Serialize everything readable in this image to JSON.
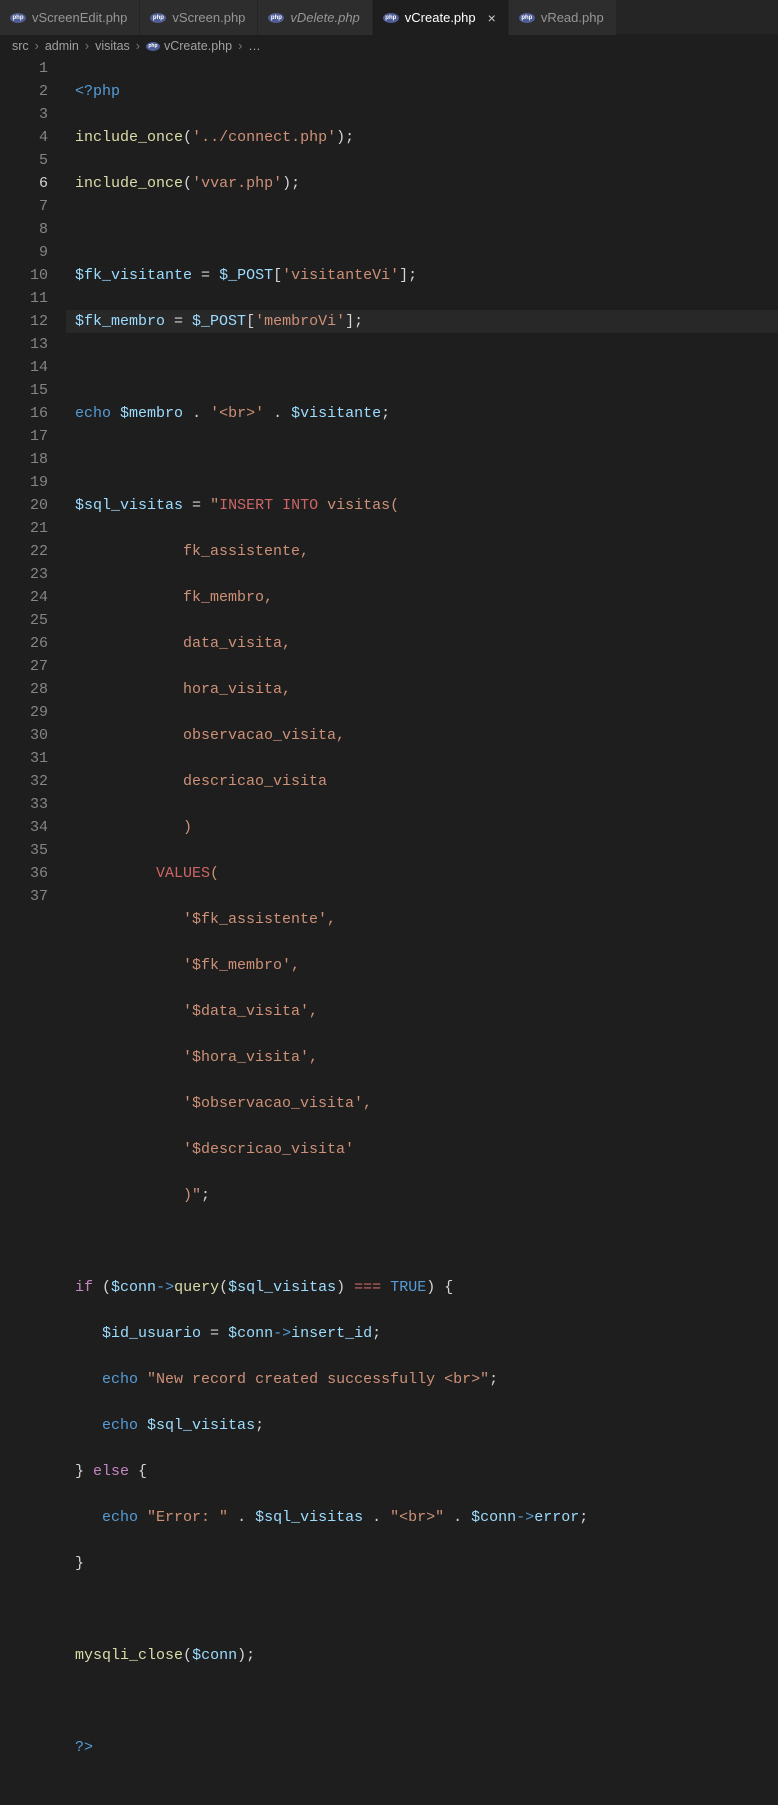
{
  "tabs": [
    {
      "label": "vScreenEdit.php",
      "active": false,
      "italic": false
    },
    {
      "label": "vScreen.php",
      "active": false,
      "italic": false
    },
    {
      "label": "vDelete.php",
      "active": false,
      "italic": true
    },
    {
      "label": "vCreate.php",
      "active": true,
      "italic": false
    },
    {
      "label": "vRead.php",
      "active": false,
      "italic": false
    }
  ],
  "breadcrumbs": {
    "parts": [
      "src",
      "admin",
      "visitas"
    ],
    "file": "vCreate.php",
    "tail": "…"
  },
  "editor": {
    "current_line": 6,
    "line_count": 37
  },
  "code": {
    "l1_open": "<?php",
    "l2_fn": "include_once",
    "l2_arg": "'../connect.php'",
    "l3_fn": "include_once",
    "l3_arg": "'vvar.php'",
    "l5_var": "$fk_visitante",
    "l5_post": "$_POST",
    "l5_key": "'visitanteVi'",
    "l6_var": "$fk_membro",
    "l6_post": "$_POST",
    "l6_key": "'membroVi'",
    "l8_echo": "echo",
    "l8_v1": "$membro",
    "l8_br": "'<br>'",
    "l8_v2": "$visitante",
    "l10_var": "$sql_visitas",
    "l10_s1": "\"",
    "l10_kw": "INSERT INTO",
    "l10_tbl": " visitas(",
    "l11": "fk_assistente,",
    "l12": "fk_membro,",
    "l13": "data_visita,",
    "l14": "hora_visita,",
    "l15": "observacao_visita,",
    "l16": "descricao_visita",
    "l17": ")",
    "l18_kw": "VALUES",
    "l18_p": "(",
    "l19": "'$fk_assistente',",
    "l20": "'$fk_membro',",
    "l21": "'$data_visita',",
    "l22": "'$hora_visita',",
    "l23": "'$observacao_visita',",
    "l24": "'$descricao_visita'",
    "l25": ")\"",
    "l27_if": "if",
    "l27_conn": "$conn",
    "l27_q": "query",
    "l27_arg": "$sql_visitas",
    "l27_true": "TRUE",
    "l28_var": "$id_usuario",
    "l28_conn": "$conn",
    "l28_prop": "insert_id",
    "l29_echo": "echo",
    "l29_str": "\"New record created successfully <br>\"",
    "l30_echo": "echo",
    "l30_var": "$sql_visitas",
    "l31_else": "else",
    "l32_echo": "echo",
    "l32_s1": "\"Error: \"",
    "l32_var": "$sql_visitas",
    "l32_s2": "\"<br>\"",
    "l32_conn": "$conn",
    "l32_prop": "error",
    "l35_fn": "mysqli_close",
    "l35_arg": "$conn",
    "l37_close": "?>"
  }
}
